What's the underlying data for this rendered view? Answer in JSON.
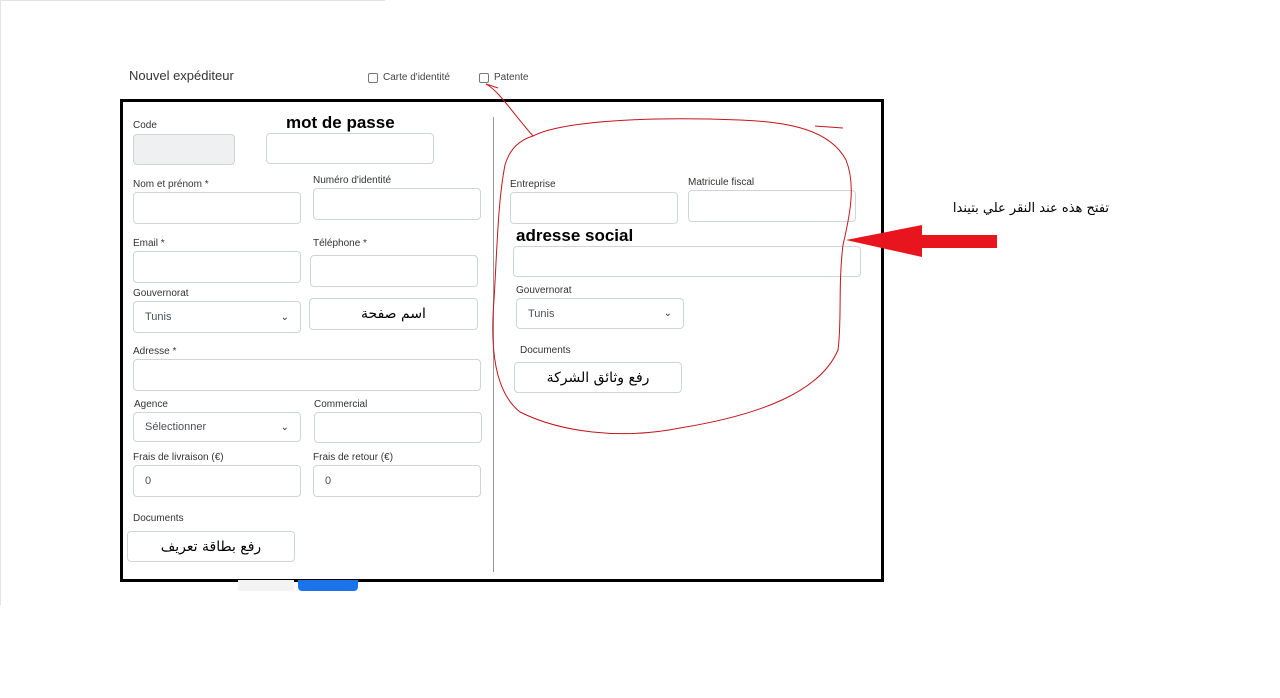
{
  "page": {
    "title": "Nouvel expéditeur"
  },
  "checkboxes": {
    "carte": "Carte d'identité",
    "patente": "Patente"
  },
  "left": {
    "code_label": "Code",
    "password_annotation": "mot de passe",
    "nom_label": "Nom et prénom *",
    "numero_label": "Numéro d'identité",
    "email_label": "Email *",
    "telephone_label": "Téléphone *",
    "gouvernorat_label": "Gouvernorat",
    "gouvernorat_value": "Tunis",
    "page_name_annotation": "اسم صفحة",
    "adresse_label": "Adresse *",
    "agence_label": "Agence",
    "agence_value": "Sélectionner",
    "commercial_label": "Commercial",
    "frais_livraison_label": "Frais de livraison (€)",
    "frais_livraison_value": "0",
    "frais_retour_label": "Frais de retour (€)",
    "frais_retour_value": "0",
    "documents_label": "Documents",
    "upload_annotation": "رفع بطاقة تعريف"
  },
  "right": {
    "entreprise_label": "Entreprise",
    "matricule_label": "Matricule fiscal",
    "adresse_social_annotation": "adresse social",
    "gouvernorat_label": "Gouvernorat",
    "gouvernorat_value": "Tunis",
    "documents_label": "Documents",
    "upload_annotation": "رفع وثائق الشركة"
  },
  "annotation": {
    "arrow_note": "تفتح هذه عند النقر علي بتيندا"
  },
  "colors": {
    "annotation_circle": "#c4161c",
    "arrow": "#e8141e",
    "primary_button": "#1a73e8"
  }
}
